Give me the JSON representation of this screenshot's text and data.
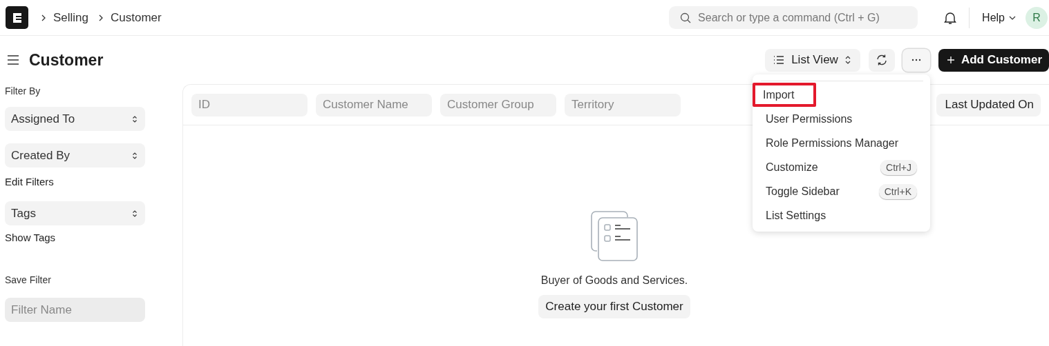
{
  "navbar": {
    "breadcrumbs": [
      "Selling",
      "Customer"
    ],
    "search": {
      "placeholder": "Search or type a command (Ctrl + G)"
    },
    "help": "Help",
    "avatar": "R"
  },
  "page": {
    "title": "Customer",
    "view_switcher": "List View",
    "primary_button": "Add Customer"
  },
  "sidebar": {
    "filter_heading": "Filter By",
    "filters": [
      "Assigned To",
      "Created By"
    ],
    "edit_filters": "Edit Filters",
    "tags": "Tags",
    "show_tags": "Show Tags",
    "save_heading": "Save Filter",
    "filter_name": {
      "placeholder": "Filter Name"
    }
  },
  "list": {
    "filter_fields": [
      {
        "placeholder": "ID"
      },
      {
        "placeholder": "Customer Name"
      },
      {
        "placeholder": "Customer Group"
      },
      {
        "placeholder": "Territory"
      }
    ],
    "sort": "Last Updated On",
    "empty_message": "Buyer of Goods and Services.",
    "empty_button": "Create your first Customer"
  },
  "menu": {
    "items": [
      {
        "label": "Import",
        "highlighted": true
      },
      {
        "label": "User Permissions",
        "highlighted": false
      },
      {
        "label": "Role Permissions Manager",
        "highlighted": false
      },
      {
        "label": "Customize",
        "shortcut": "Ctrl+J",
        "highlighted": false
      },
      {
        "label": "Toggle Sidebar",
        "shortcut": "Ctrl+K",
        "highlighted": false
      },
      {
        "label": "List Settings",
        "highlighted": false
      }
    ]
  }
}
